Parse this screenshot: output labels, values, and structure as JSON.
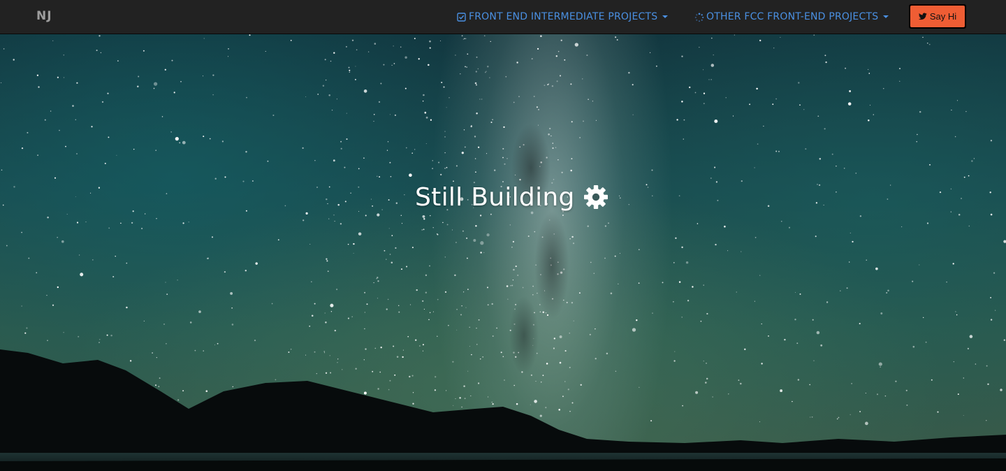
{
  "navbar": {
    "brand": "NJ",
    "menus": [
      {
        "label": "FRONT END INTERMEDIATE PROJECTS",
        "icon": "check-square-icon"
      },
      {
        "label": "OTHER FCC FRONT-END PROJECTS",
        "icon": "spinner-icon"
      }
    ],
    "say_hi": {
      "label": "Say Hi",
      "icon": "twitter-icon"
    }
  },
  "hero": {
    "title": "Still Building",
    "icon": "gear-icon",
    "background": "night-sky-milky-way-mountains"
  },
  "colors": {
    "navbar_bg": "#222222",
    "nav_link": "#4a90e2",
    "brand": "#9d9d9d",
    "button_accent": "#ef5d34",
    "title": "#ffffff"
  }
}
